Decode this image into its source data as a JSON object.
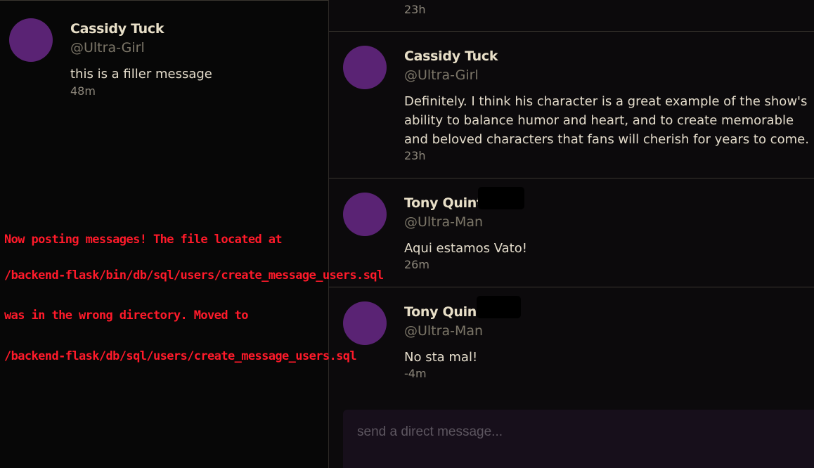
{
  "message_groups": [
    {
      "display_name": "Cassidy Tuck",
      "handle": "@Ultra-Girl",
      "message": "this is a filler message",
      "time": "48m"
    }
  ],
  "messages": [
    {
      "time": "23h"
    },
    {
      "display_name": "Cassidy Tuck",
      "handle": "@Ultra-Girl",
      "message": "Definitely. I think his character is a great example of the show's ability to balance humor and heart, and to create memorable and beloved characters that fans will cherish for years to come.",
      "time": "23h"
    },
    {
      "display_name": "Tony Quint",
      "handle": "@Ultra-Man",
      "message": "Aqui estamos Vato!",
      "time": "26m"
    },
    {
      "display_name": "Tony Quint",
      "handle": "@Ultra-Man",
      "message": "No sta mal!",
      "time": "-4m"
    }
  ],
  "annotation": {
    "line1": "Now posting messages! The file located at",
    "line2": "/backend-flask/bin/db/sql/users/create_message_users.sql",
    "line3": "was in the wrong directory. Moved to",
    "line4": "/backend-flask/db/sql/users/create_message_users.sql",
    "color": "#ff1a2a"
  },
  "composer": {
    "placeholder": "send a direct message..."
  },
  "colors": {
    "avatar": "#5a2374",
    "background": "#070707"
  }
}
